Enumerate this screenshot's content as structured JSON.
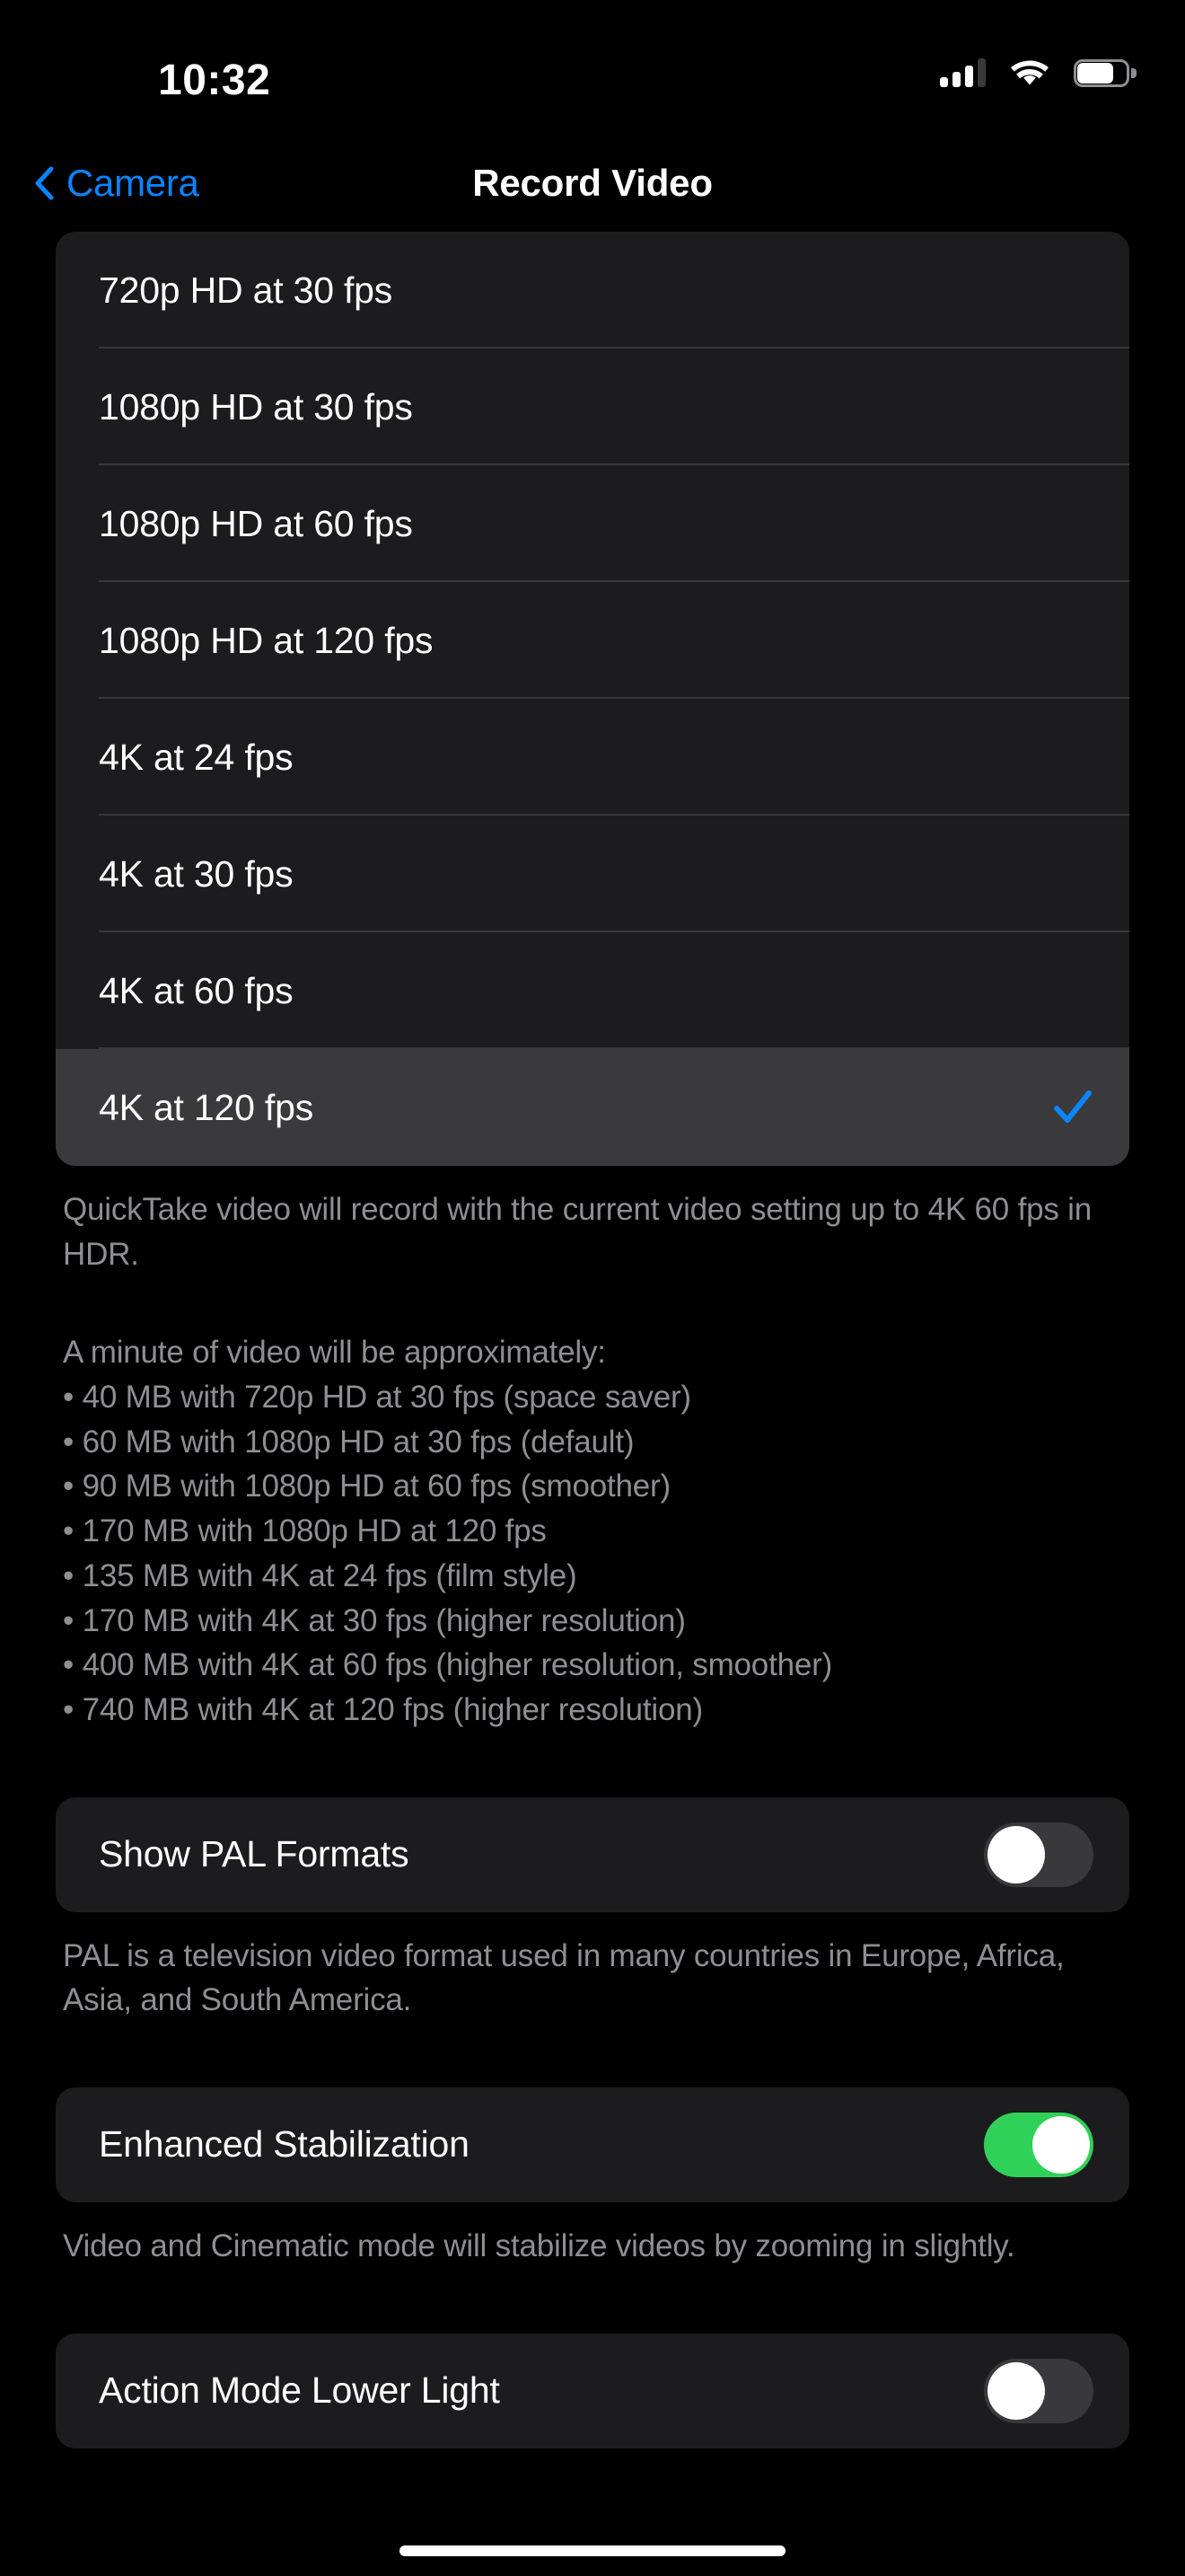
{
  "status_bar": {
    "time": "10:32",
    "cellular_icon": "cellular-signal-icon",
    "cellular_bars_filled": 3,
    "cellular_bars_total": 4,
    "wifi_icon": "wifi-icon",
    "battery_icon": "battery-icon",
    "battery_level_percent": 64
  },
  "nav": {
    "back_label": "Camera",
    "back_icon": "chevron-left-icon",
    "title": "Record Video"
  },
  "colors": {
    "accent_blue": "#0A84FF",
    "toggle_on_green": "#30D158",
    "card_background": "#1C1C1E",
    "selected_row": "#3A3A3C",
    "page_background": "#000000",
    "secondary_text": "#8E8E93"
  },
  "format_options": [
    {
      "label": "720p HD at 30 fps",
      "selected": false
    },
    {
      "label": "1080p HD at 30 fps",
      "selected": false
    },
    {
      "label": "1080p HD at 60 fps",
      "selected": false
    },
    {
      "label": "1080p HD at 120 fps",
      "selected": false
    },
    {
      "label": "4K at 24 fps",
      "selected": false
    },
    {
      "label": "4K at 30 fps",
      "selected": false
    },
    {
      "label": "4K at 60 fps",
      "selected": false
    },
    {
      "label": "4K at 120 fps",
      "selected": true
    }
  ],
  "selected_format": "4K at 120 fps",
  "check_icon": "checkmark-icon",
  "footers": {
    "quicktake": "QuickTake video will record with the current video setting up to 4K 60 fps in HDR.",
    "sizes_intro": "A minute of video will be approximately:",
    "sizes_list": "• 40 MB with 720p HD at 30 fps (space saver)\n• 60 MB with 1080p HD at 30 fps (default)\n• 90 MB with 1080p HD at 60 fps (smoother)\n• 170 MB with 1080p HD at 120 fps\n• 135 MB with 4K at 24 fps (film style)\n• 170 MB with 4K at 30 fps (higher resolution)\n• 400 MB with 4K at 60 fps (higher resolution, smoother)\n• 740 MB with 4K at 120 fps (higher resolution)",
    "pal": "PAL is a television video format used in many countries in Europe, Africa, Asia, and South America.",
    "stabilization": "Video and Cinematic mode will stabilize videos by zooming in slightly."
  },
  "toggles": {
    "pal": {
      "label": "Show PAL Formats",
      "on": false
    },
    "stabilization": {
      "label": "Enhanced Stabilization",
      "on": true
    },
    "action_mode": {
      "label": "Action Mode Lower Light",
      "on": false
    }
  }
}
